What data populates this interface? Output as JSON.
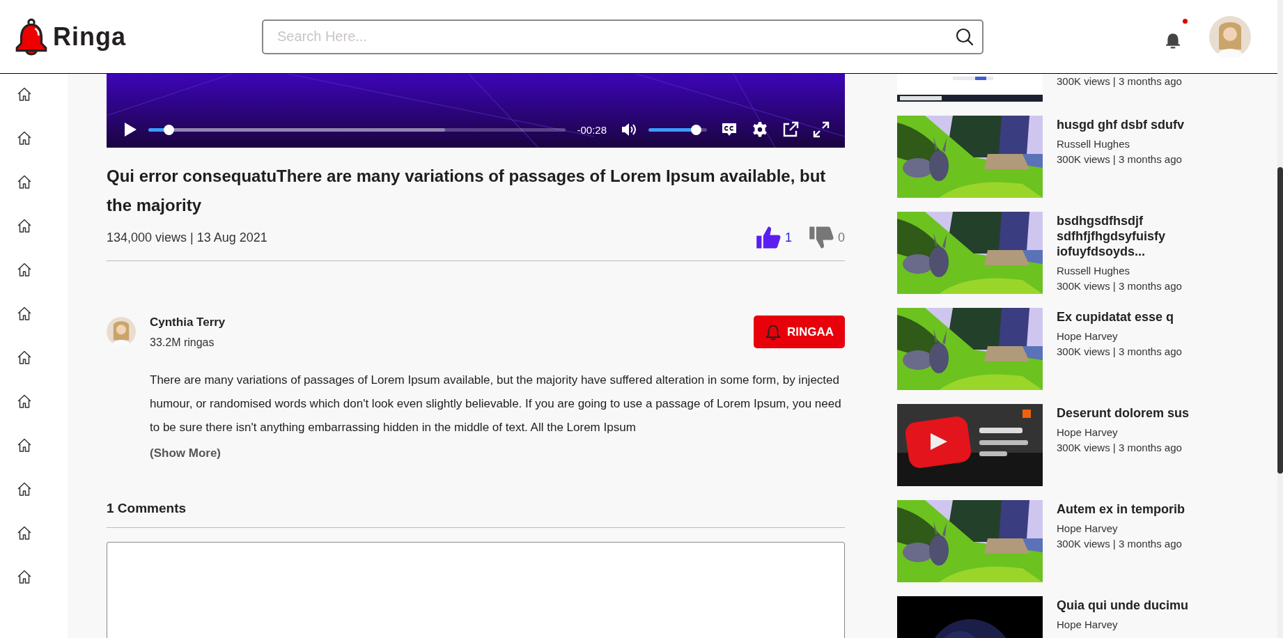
{
  "header": {
    "logo": "Ringa",
    "search": {
      "placeholder": "Search Here..."
    },
    "notifications": {
      "unread": true
    }
  },
  "player": {
    "progress": {
      "level": 0.05,
      "buffer": {
        "level": 0.71
      }
    },
    "time": "-00:28",
    "volume": {
      "level": 0.82
    }
  },
  "video": {
    "title": "Qui error consequatuThere are many variations of passages of Lorem Ipsum available, but the majority",
    "meta": "134,000 views | 13 Aug 2021",
    "like": {
      "count": "1",
      "selected": true
    },
    "dislike": {
      "count": "0",
      "selected": false
    }
  },
  "channel": {
    "name": "Cynthia Terry",
    "subscribers": "33.2M ringas",
    "button": "RINGAA"
  },
  "description": "There are many variations of passages of Lorem Ipsum available, but the majority have suffered alteration in some form, by injected humour, or randomised words which don't look even slightly believable. If you are going to use a passage of Lorem Ipsum, you need to be sure there isn't anything embarrassing hidden in the middle of text. All the Lorem Ipsum",
  "show_more": "(Show More)",
  "comments": {
    "heading": "1 Comments"
  },
  "related": [
    {
      "meta": "300K views | 3 months ago"
    },
    {
      "title": "husgd ghf dsbf sdufv",
      "author": "Russell Hughes",
      "meta": "300K views | 3 months ago"
    },
    {
      "title": "bsdhgsdfhsdjf sdfhfjfhgdsyfuisfy iofuyfdsoyds...",
      "author": "Russell Hughes",
      "meta": "300K views | 3 months ago"
    },
    {
      "title": "Ex cupidatat esse q",
      "author": "Hope Harvey",
      "meta": "300K views | 3 months ago"
    },
    {
      "title": "Deserunt dolorem sus",
      "author": "Hope Harvey",
      "meta": "300K views | 3 months ago"
    },
    {
      "title": "Autem ex in temporib",
      "author": "Hope Harvey",
      "meta": "300K views | 3 months ago"
    },
    {
      "title": "Quia qui unde ducimu",
      "author": "Hope Harvey"
    }
  ]
}
